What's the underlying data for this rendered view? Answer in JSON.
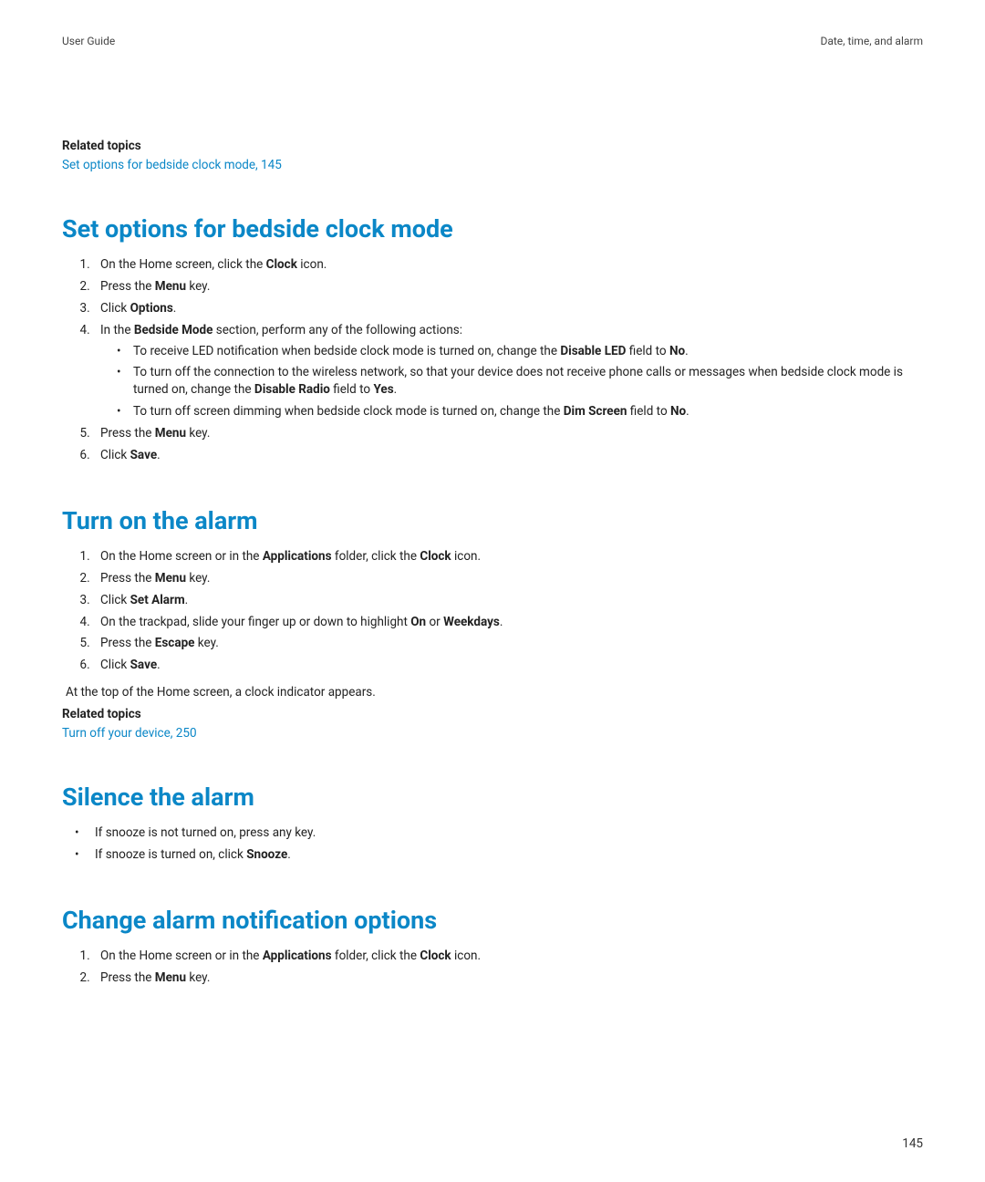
{
  "header": {
    "left": "User Guide",
    "right": "Date, time, and alarm"
  },
  "page_number": "145",
  "related1": {
    "heading": "Related topics",
    "link": "Set options for bedside clock mode, 145"
  },
  "section1": {
    "title": "Set options for bedside clock mode",
    "step1_a": "On the Home screen, click the ",
    "step1_b": "Clock",
    "step1_c": " icon.",
    "step2_a": "Press the ",
    "step2_b": "Menu",
    "step2_c": " key.",
    "step3_a": "Click ",
    "step3_b": "Options",
    "step3_c": ".",
    "step4_a": "In the ",
    "step4_b": "Bedside Mode",
    "step4_c": " section, perform any of the following actions:",
    "sub1_a": "To receive LED notification when bedside clock mode is turned on, change the ",
    "sub1_b": "Disable LED",
    "sub1_c": " field to ",
    "sub1_d": "No",
    "sub1_e": ".",
    "sub2_a": "To turn off the connection to the wireless network, so that your device does not receive phone calls or messages when bedside clock mode is turned on, change the ",
    "sub2_b": "Disable Radio",
    "sub2_c": " field to ",
    "sub2_d": "Yes",
    "sub2_e": ".",
    "sub3_a": "To turn off screen dimming when bedside clock mode is turned on, change the ",
    "sub3_b": "Dim Screen",
    "sub3_c": " field to ",
    "sub3_d": "No",
    "sub3_e": ".",
    "step5_a": "Press the ",
    "step5_b": "Menu",
    "step5_c": " key.",
    "step6_a": "Click ",
    "step6_b": "Save",
    "step6_c": "."
  },
  "section2": {
    "title": "Turn on the alarm",
    "step1_a": "On the Home screen or in the ",
    "step1_b": "Applications",
    "step1_c": " folder, click the ",
    "step1_d": "Clock",
    "step1_e": " icon.",
    "step2_a": "Press the ",
    "step2_b": "Menu",
    "step2_c": " key.",
    "step3_a": "Click ",
    "step3_b": "Set Alarm",
    "step3_c": ".",
    "step4_a": "On the trackpad, slide your finger up or down to highlight ",
    "step4_b": "On",
    "step4_c": " or ",
    "step4_d": "Weekdays",
    "step4_e": ".",
    "step5_a": "Press the ",
    "step5_b": "Escape",
    "step5_c": " key.",
    "step6_a": "Click ",
    "step6_b": "Save",
    "step6_c": ".",
    "note": "At the top of the Home screen, a clock indicator appears."
  },
  "related2": {
    "heading": "Related topics",
    "link": "Turn off your device, 250"
  },
  "section3": {
    "title": "Silence the alarm",
    "b1": "If snooze is not turned on, press any key.",
    "b2_a": "If snooze is turned on, click ",
    "b2_b": "Snooze",
    "b2_c": "."
  },
  "section4": {
    "title": "Change alarm notification options",
    "step1_a": "On the Home screen or in the ",
    "step1_b": "Applications",
    "step1_c": " folder, click the ",
    "step1_d": "Clock",
    "step1_e": " icon.",
    "step2_a": "Press the ",
    "step2_b": "Menu",
    "step2_c": " key."
  }
}
